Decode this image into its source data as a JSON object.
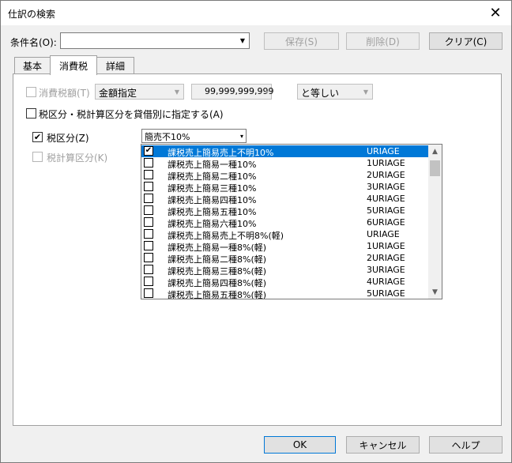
{
  "window": {
    "title": "仕訳の検索",
    "close_glyph": "✕"
  },
  "header": {
    "condition_label": "条件名(O):",
    "condition_value": "",
    "save_label": "保存(S)",
    "delete_label": "削除(D)",
    "clear_label": "クリア(C)"
  },
  "tabs": [
    {
      "label": "基本"
    },
    {
      "label": "消費税"
    },
    {
      "label": "詳細"
    }
  ],
  "tax": {
    "amount_label": "消費税額(T)",
    "amount_mode": "金額指定",
    "amount_value": "99,999,999,999",
    "compare_mode": "と等しい",
    "debit_credit_label": "税区分・税計算区分を貸借別に指定する(A)",
    "tax_category_label": "税区分(Z)",
    "tax_category_value": "簡売不10%",
    "tax_calc_label": "税計算区分(K)",
    "tax_category_checked": "✔"
  },
  "tax_list": [
    {
      "name": "課税売上簡易売上不明10%",
      "code": "URIAGE",
      "checked": "✔"
    },
    {
      "name": "課税売上簡易一種10%",
      "code": "1URIAGE",
      "checked": ""
    },
    {
      "name": "課税売上簡易二種10%",
      "code": "2URIAGE",
      "checked": ""
    },
    {
      "name": "課税売上簡易三種10%",
      "code": "3URIAGE",
      "checked": ""
    },
    {
      "name": "課税売上簡易四種10%",
      "code": "4URIAGE",
      "checked": ""
    },
    {
      "name": "課税売上簡易五種10%",
      "code": "5URIAGE",
      "checked": ""
    },
    {
      "name": "課税売上簡易六種10%",
      "code": "6URIAGE",
      "checked": ""
    },
    {
      "name": "課税売上簡易売上不明8%(軽)",
      "code": "URIAGE",
      "checked": ""
    },
    {
      "name": "課税売上簡易一種8%(軽)",
      "code": "1URIAGE",
      "checked": ""
    },
    {
      "name": "課税売上簡易二種8%(軽)",
      "code": "2URIAGE",
      "checked": ""
    },
    {
      "name": "課税売上簡易三種8%(軽)",
      "code": "3URIAGE",
      "checked": ""
    },
    {
      "name": "課税売上簡易四種8%(軽)",
      "code": "4URIAGE",
      "checked": ""
    },
    {
      "name": "課税売上簡易五種8%(軽)",
      "code": "5URIAGE",
      "checked": ""
    }
  ],
  "footer": {
    "ok_label": "OK",
    "cancel_label": "キャンセル",
    "help_label": "ヘルプ"
  },
  "icons": {
    "dropdown_arrow": "▼",
    "small_arrow": "▾",
    "scroll_up": "▲",
    "scroll_down": "▼"
  },
  "colors": {
    "selection": "#0078d7"
  }
}
